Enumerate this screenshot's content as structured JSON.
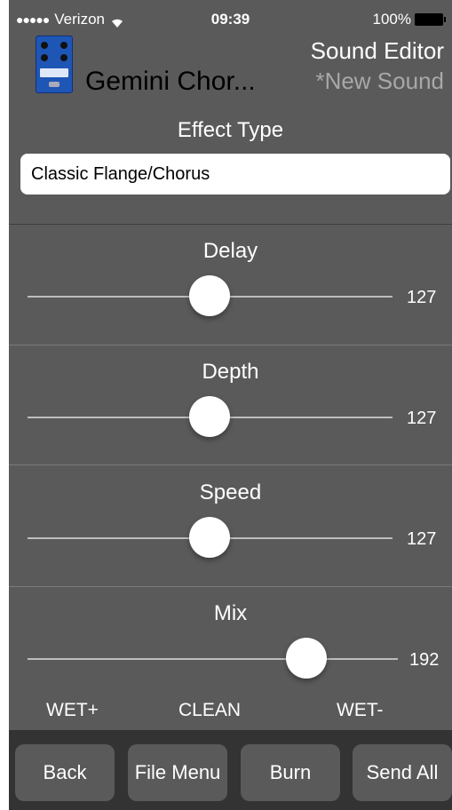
{
  "status_bar": {
    "signal_dots": "●●●●●",
    "carrier": "Verizon",
    "time": "09:39",
    "battery": "100%"
  },
  "header": {
    "pedal_icon": "gemini-chorus-pedal-icon",
    "device_name": "Gemini Chor...",
    "title": "Sound Editor",
    "subtitle": "*New Sound"
  },
  "effect": {
    "label": "Effect Type",
    "value": "Classic Flange/Chorus"
  },
  "params": {
    "delay": {
      "label": "Delay",
      "value": "127",
      "max": 255
    },
    "depth": {
      "label": "Depth",
      "value": "127",
      "max": 255
    },
    "speed": {
      "label": "Speed",
      "value": "127",
      "max": 255
    },
    "mix": {
      "label": "Mix",
      "value": "192",
      "max": 255
    }
  },
  "mix_labels": {
    "left": "WET+",
    "center": "CLEAN",
    "right": "WET-"
  },
  "buttons": {
    "back": "Back",
    "file_menu": "File Menu",
    "burn": "Burn",
    "send_all": "Send All"
  },
  "colors": {
    "background": "#5a5a5a",
    "bottom_bar": "#333333",
    "button": "#5a5a5a",
    "subtitle": "#a8a8a8"
  }
}
